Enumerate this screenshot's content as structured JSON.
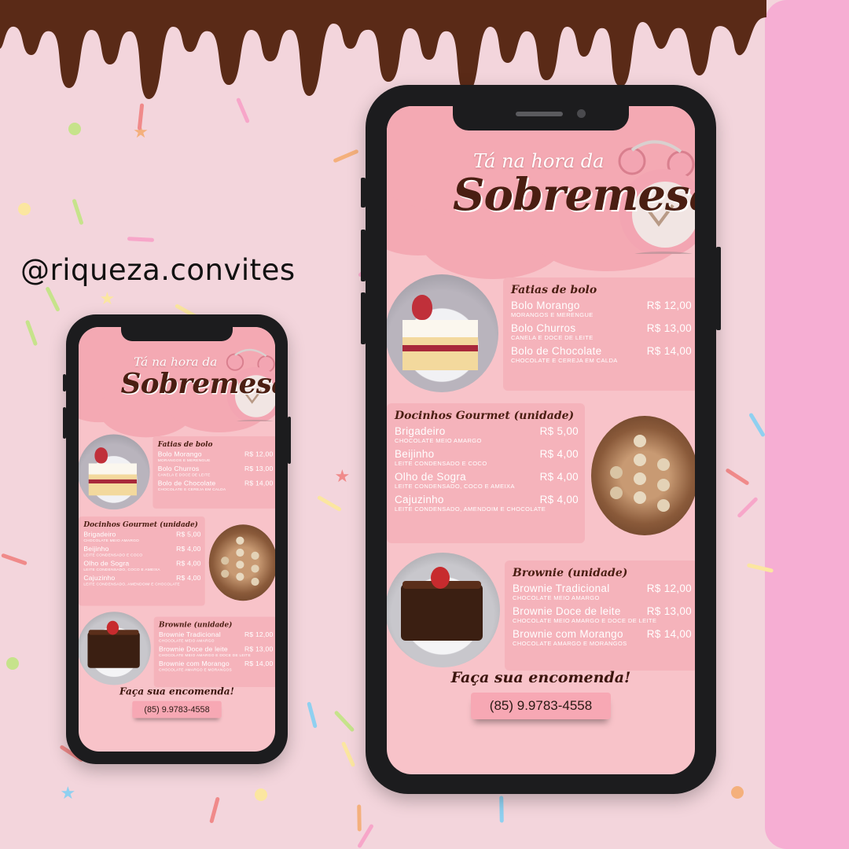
{
  "handle": "@riqueza.convites",
  "colors": {
    "background": "#f3d5dc",
    "accent_strip": "#f6aed3",
    "screen": "#f8c3c9",
    "card": "#f5b3bb",
    "chocolate": "#4a1e12"
  },
  "menu": {
    "title_top": "Tá na hora da",
    "title_main": "Sobremesa",
    "sections": [
      {
        "title": "Fatias de bolo",
        "items": [
          {
            "name": "Bolo Morango",
            "price": "R$ 12,00",
            "desc": "MORANGOS E MERENGUE"
          },
          {
            "name": "Bolo Churros",
            "price": "R$ 13,00",
            "desc": "CANELA E DOCE DE LEITE"
          },
          {
            "name": "Bolo de Chocolate",
            "price": "R$ 14,00",
            "desc": "CHOCOLATE E CEREJA EM CALDA"
          }
        ]
      },
      {
        "title": "Docinhos Gourmet (unidade)",
        "items": [
          {
            "name": "Brigadeiro",
            "price": "R$ 5,00",
            "desc": "CHOCOLATE MEIO AMARGO"
          },
          {
            "name": "Beijinho",
            "price": "R$ 4,00",
            "desc": "LEITE CONDENSADO E COCO"
          },
          {
            "name": "Olho de Sogra",
            "price": "R$ 4,00",
            "desc": "LEITE CONDENSADO, COCO E AMEIXA"
          },
          {
            "name": "Cajuzinho",
            "price": "R$ 4,00",
            "desc": "LEITE CONDENSADO, AMENDOIM E CHOCOLATE"
          }
        ]
      },
      {
        "title": "Brownie (unidade)",
        "items": [
          {
            "name": "Brownie Tradicional",
            "price": "R$ 12,00",
            "desc": "CHOCOLATE MEIO AMARGO"
          },
          {
            "name": "Brownie Doce de leite",
            "price": "R$ 13,00",
            "desc": "CHOCOLATE MEIO AMARGO E DOCE DE LEITE"
          },
          {
            "name": "Brownie com Morango",
            "price": "R$ 14,00",
            "desc": "CHOCOLATE AMARGO E MORANGOS"
          }
        ]
      }
    ],
    "order_title": "Faça sua encomenda!",
    "phone": "(85) 9.9783-4558"
  },
  "icons": [
    "clock-icon",
    "cake-slice-photo",
    "bonbons-photo",
    "brownie-photo"
  ]
}
